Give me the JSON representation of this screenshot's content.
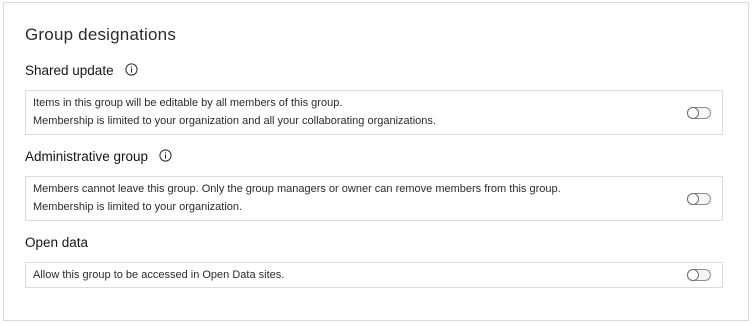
{
  "panel": {
    "title": "Group designations"
  },
  "sections": [
    {
      "heading": "Shared update",
      "has_info_icon": true,
      "info_icon": "info-circle-icon",
      "lines": [
        "Items in this group will be editable by all members of this group.",
        "Membership is limited to your organization and all your collaborating organizations."
      ],
      "toggle_on": false
    },
    {
      "heading": "Administrative group",
      "has_info_icon": true,
      "info_icon": "info-circle-icon",
      "lines": [
        "Members cannot leave this group. Only the group managers or owner can remove members from this group.",
        "Membership is limited to your organization."
      ],
      "toggle_on": false
    },
    {
      "heading": "Open data",
      "has_info_icon": false,
      "lines": [
        "Allow this group to be accessed in Open Data sites."
      ],
      "toggle_on": false
    }
  ],
  "colors": {
    "panel_border": "#d9d9d9",
    "box_border": "#dcdcdc",
    "text": "#151515",
    "toggle_border": "#8f8f8f"
  }
}
